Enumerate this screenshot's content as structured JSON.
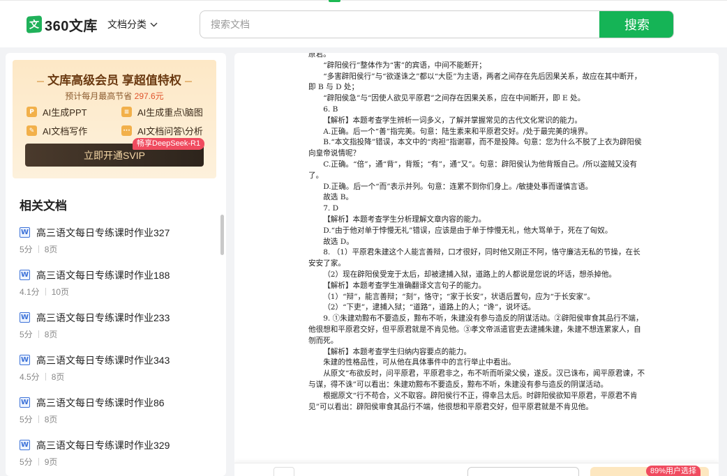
{
  "header": {
    "logo_text": "360文库",
    "logo_mark": "文",
    "category_label": "文档分类",
    "search_placeholder": "搜索文档",
    "search_button": "搜索"
  },
  "vip": {
    "title": "文库高级会员 享超值特权",
    "subtitle_prefix": "预计每月最高节省",
    "subtitle_amount": "297.6元",
    "features": [
      {
        "icon": "P",
        "icon_name": "ppt-icon",
        "label": "AI生成PPT"
      },
      {
        "icon": "≡",
        "icon_name": "mindmap-icon",
        "label": "AI生成重点\\脑图"
      },
      {
        "icon": "✎",
        "icon_name": "write-icon",
        "label": "AI文档写作"
      },
      {
        "icon": "···",
        "icon_name": "chat-icon",
        "label": "AI文档问答\\分析"
      }
    ],
    "cta": "立即开通SVIP",
    "badge": "畅享DeepSeek-R1"
  },
  "related": {
    "title": "相关文档",
    "items": [
      {
        "title": "高三语文每日专练课时作业327",
        "score": "5分",
        "pages": "8页"
      },
      {
        "title": "高三语文每日专练课时作业188",
        "score": "4.1分",
        "pages": "10页"
      },
      {
        "title": "高三语文每日专练课时作业233",
        "score": "5分",
        "pages": "8页"
      },
      {
        "title": "高三语文每日专练课时作业343",
        "score": "4.5分",
        "pages": "8页"
      },
      {
        "title": "高三语文每日专练课时作业86",
        "score": "5分",
        "pages": "8页"
      },
      {
        "title": "高三语文每日专练课时作业329",
        "score": "5分",
        "pages": "9页"
      }
    ]
  },
  "document": {
    "lines": [
      {
        "t": "原君。",
        "i": false
      },
      {
        "t": "“辟阳侯行”整体作为“害”的宾语，中间不能断开；",
        "i": true
      },
      {
        "t": "“多害辟阳侯行”与“欲遂诛之”都以“大臣”为主语，两者之间存在先后因果关系，故应在其中断开，即 B 与 D 处；",
        "i": true
      },
      {
        "t": "“辟阳侯急”与“因使人欲见平原君”之间存在因果关系，应在中间断开，即 E 处。",
        "i": true
      },
      {
        "t": "6. B",
        "i": true
      },
      {
        "t": "【解析】本题考查学生辨析一词多义，了解并掌握常见的古代文化常识的能力。",
        "i": true
      },
      {
        "t": "A.正确。后一个“善”指完美。句意：陆生素来和平原君交好。/处于最完美的境界。",
        "i": true
      },
      {
        "t": "B.“本文指投降”错误，本文中的“肉袒”指谢罪，而不是投降。句意：您为什么不脱了上衣为辟阳侯向皇帝说情呢？",
        "i": true
      },
      {
        "t": "C.正确。“倍”，通“背”，背叛；“有”，通“又”。句意：辟阳侯认为他背叛自己。/所以盗贼又没有了。",
        "i": true
      },
      {
        "t": "D.正确。后一个“而”表示并列。句意：连累不到你们身上。/敏捷处事而谨慎言语。",
        "i": true
      },
      {
        "t": "故选 B。",
        "i": true
      },
      {
        "t": "7. D",
        "i": true
      },
      {
        "t": "【解析】本题考查学生分析理解文章内容的能力。",
        "i": true
      },
      {
        "t": "D.“由于他对单于悖慢无礼”错误，应该是由于单于悖慢无礼，他大骂单于，死在了匈奴。",
        "i": true
      },
      {
        "t": "故选 D。",
        "i": true
      },
      {
        "t": "8. （1）平原君朱建这个人能言善辩，口才很好，同时他又刚正不阿，恪守廉洁无私的节操，在长安安了家。",
        "i": true
      },
      {
        "t": "（2）现在辟阳侯受宠于太后，却被逮捕入狱，道路上的人都说是您说的坏话，想杀掉他。",
        "i": true
      },
      {
        "t": "【解析】本题考查学生准确翻译文言句子的能力。",
        "i": true
      },
      {
        "t": "（1）“辩”，能言善辩；“刻”，恪守；“家于长安”，状语后置句，应为“于长安家”。",
        "i": true
      },
      {
        "t": "（2）“下吏”，逮捕入狱；“道路”，道路上的人；“谗”，说坏话。",
        "i": true
      },
      {
        "t": "9. ①朱建劝黥布不要造反，黥布不听，朱建没有参与造反的阴谋活动。②辟阳侯审食其品行不端，他很想和平原君交好，但平原君就是不肯见他。③孝文帝派遣官吏去逮捕朱建，朱建不想连累家人，自刎而死。",
        "i": true
      },
      {
        "t": "【解析】本题考查学生归纳内容要点的能力。",
        "i": true
      },
      {
        "t": "朱建的性格品性，可从他在具体事件中的言行举止中看出。",
        "i": true
      },
      {
        "t": "从原文“布欲反时，问平原君，平原君非之，布不听而听梁父侯，遂反。汉已诛布，闻平原君谏，不与谋，得不诛”可以看出：朱建劝黥布不要造反，黥布不听，朱建没有参与造反的阴谋活动。",
        "i": true
      },
      {
        "t": "根据原文“行不苟合，义不取容。辟阳侯行不正，得幸吕太后。时辟阳侯欲知平原君，平原君不肯见”可以看出：辟阳侯审食其品行不端，他很想和平原君交好，但平原君就是不肯见他。",
        "i": true
      }
    ]
  },
  "bottom": {
    "badge": "89%用户选择"
  }
}
